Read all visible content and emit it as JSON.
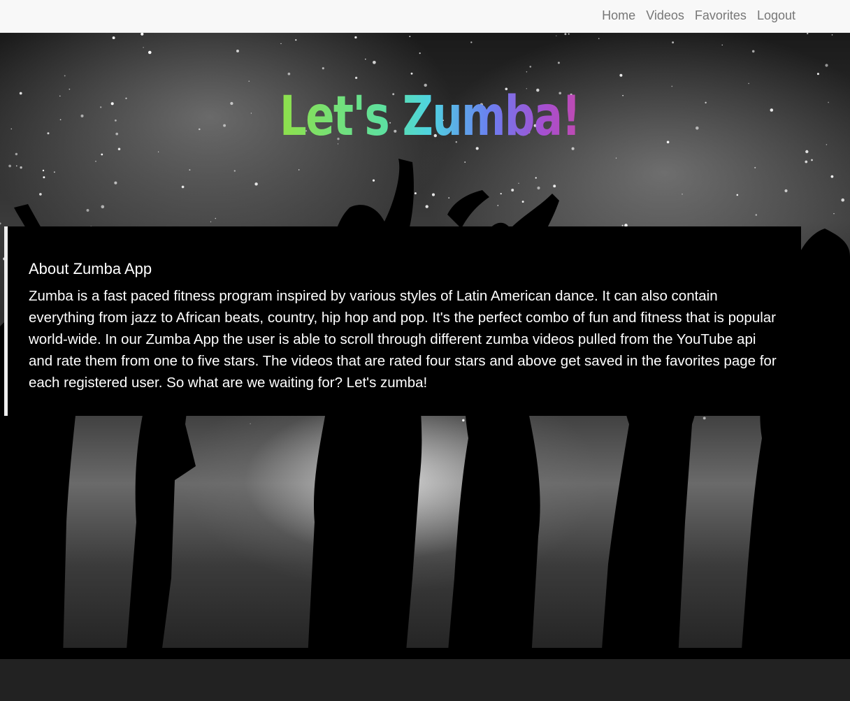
{
  "nav": {
    "items": [
      {
        "label": "Home"
      },
      {
        "label": "Videos"
      },
      {
        "label": "Favorites"
      },
      {
        "label": "Logout"
      }
    ]
  },
  "hero": {
    "title": "Let's Zumba!"
  },
  "about": {
    "heading": "About Zumba App",
    "body": "Zumba is a fast paced fitness program inspired by various styles of Latin American dance. It can also contain everything from jazz to African beats, country, hip hop and pop. It's the perfect combo of fun and fitness that is popular world-wide. In our Zumba App the user is able to scroll through different zumba videos pulled from the YouTube api and rate them from one to five stars. The videos that are rated four stars and above get saved in the favorites page for each registered user. So what are we waiting for? Let's zumba!"
  },
  "colors": {
    "navbar_bg": "#f8f8f8",
    "nav_link": "#777777",
    "about_bg": "#000000",
    "footer_bg": "#222222"
  }
}
